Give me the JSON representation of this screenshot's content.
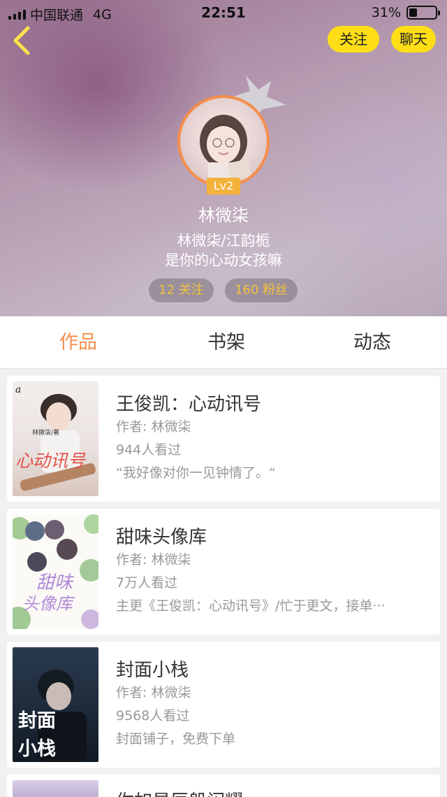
{
  "status_bar": {
    "carrier": "中国联通",
    "network": "4G",
    "time": "22:51",
    "battery": "31%",
    "battery_level": 0.31
  },
  "header": {
    "follow_label": "关注",
    "chat_label": "聊天",
    "level": "Lv2",
    "username": "林微柒",
    "bio_line1": "林微柒/江韵栀",
    "bio_line2": "是你的心动女孩嘛",
    "following": "12 关注",
    "fans": "160 粉丝"
  },
  "tabs": [
    {
      "label": "作品",
      "active": true
    },
    {
      "label": "书架",
      "active": false
    },
    {
      "label": "动态",
      "active": false
    }
  ],
  "books": [
    {
      "title": "王俊凯：心动讯号",
      "author": "作者: 林微柒",
      "views": "944人看过",
      "desc": "“我好像对你一见钟情了。“",
      "cover_text": "心动讯号",
      "cover_author": "林微柒/著",
      "cover_top": "a"
    },
    {
      "title": "甜味头像库",
      "author": "作者: 林微柒",
      "views": "7万人看过",
      "desc": "主更《王俊凯：心动讯号》/忙于更文，接单···",
      "cover_text": "甜味",
      "cover_text2": "头像库"
    },
    {
      "title": "封面小栈",
      "author": "作者: 林微柒",
      "views": "9568人看过",
      "desc": "封面铺子，免费下单",
      "cover_text": "封面",
      "cover_text2": "小栈"
    },
    {
      "title": "你如星辰般闪耀",
      "author": "",
      "views": "",
      "desc": ""
    }
  ],
  "colors": {
    "accent": "#f58e4b",
    "button_yellow": "#ffde17",
    "stat_text": "#f3c33b"
  }
}
